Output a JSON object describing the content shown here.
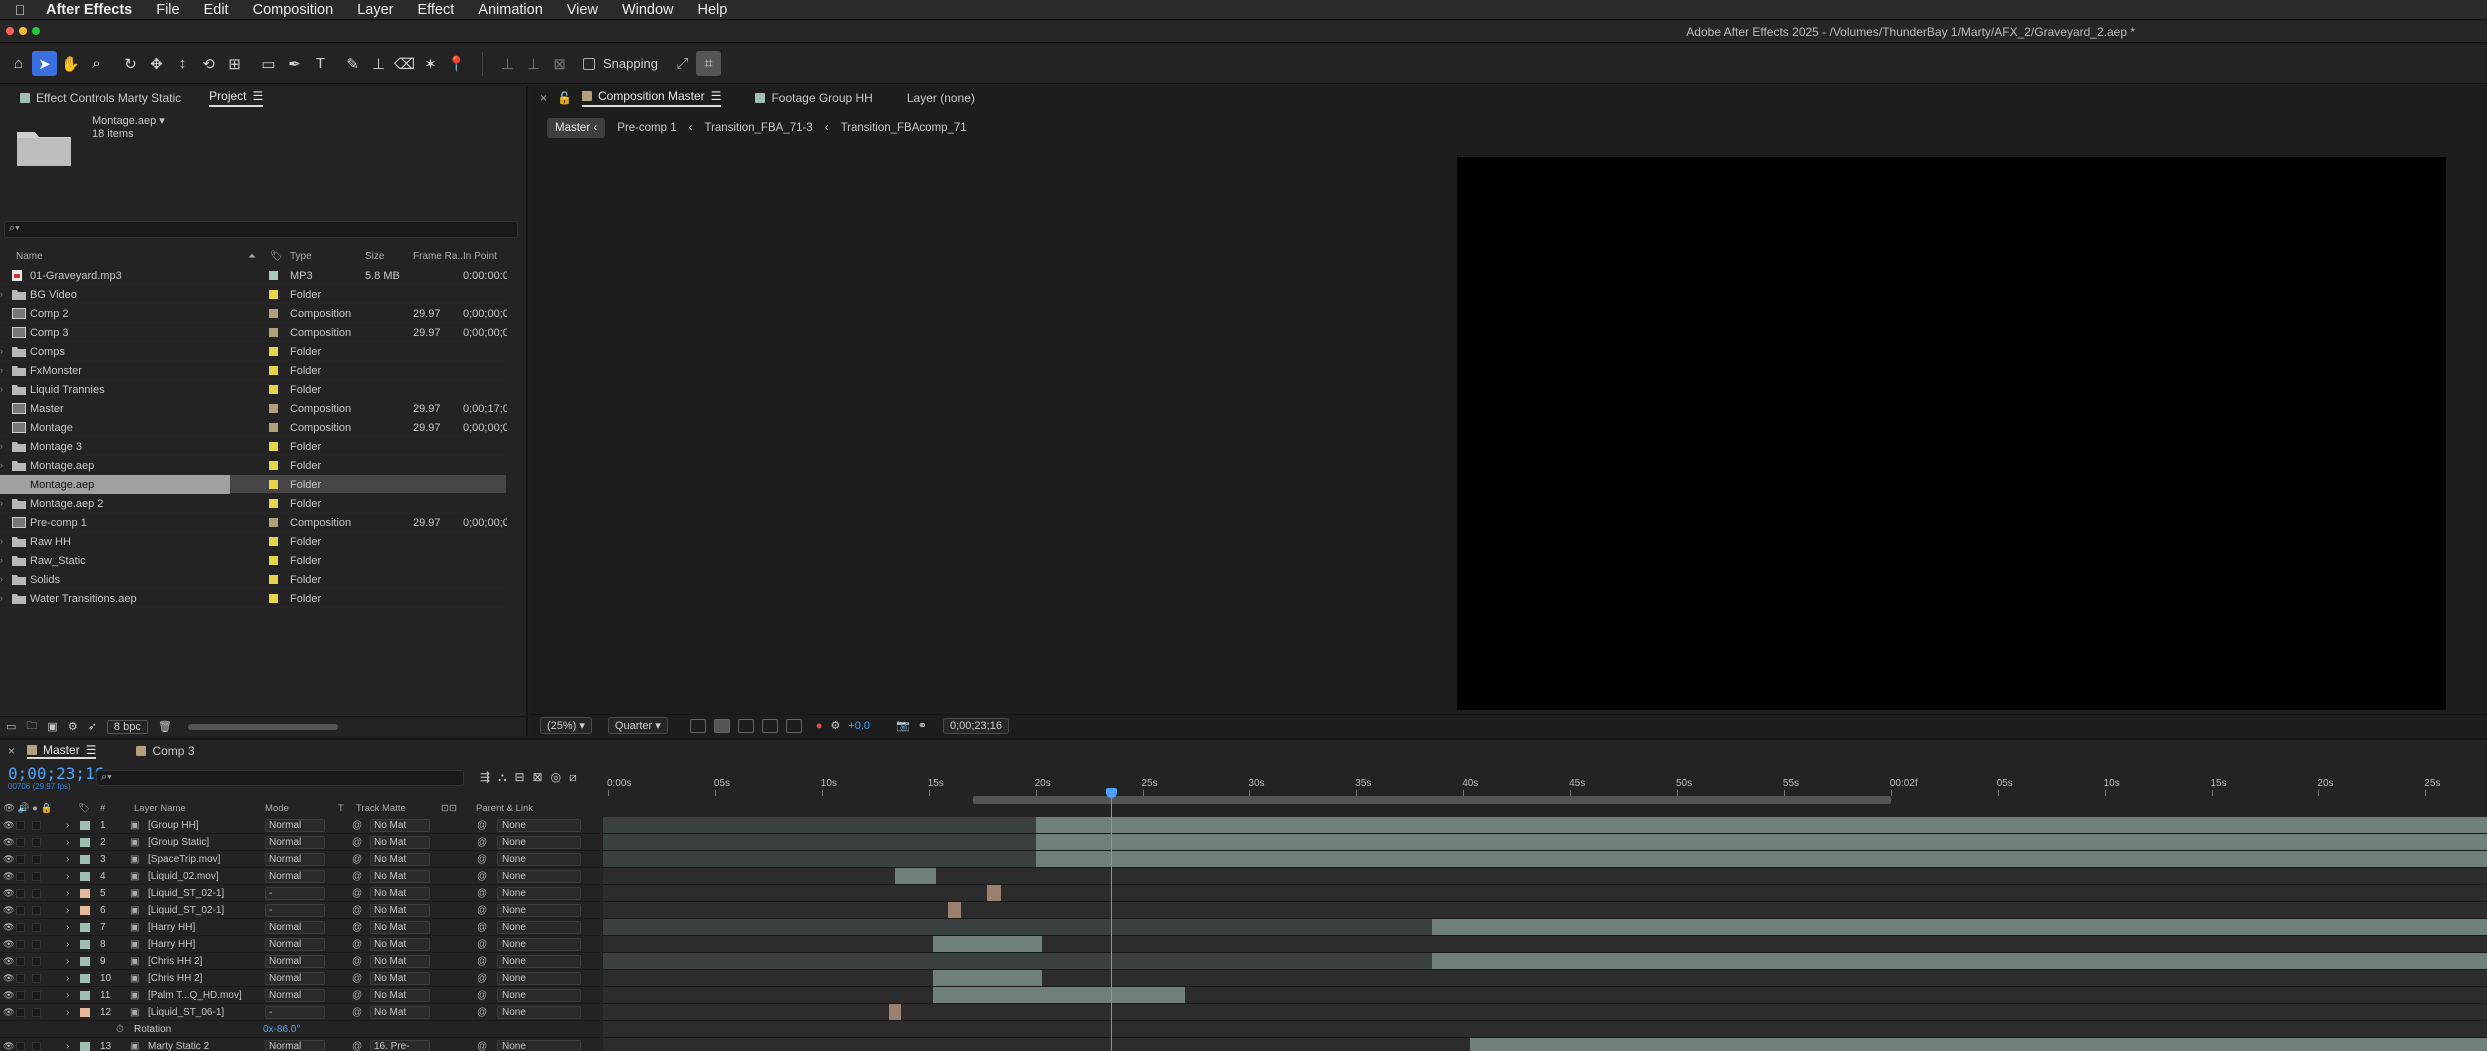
{
  "menubar": {
    "app_name": "After Effects",
    "items": [
      "File",
      "Edit",
      "Composition",
      "Layer",
      "Effect",
      "Animation",
      "View",
      "Window",
      "Help"
    ]
  },
  "window": {
    "title": "Adobe After Effects 2025 - /Volumes/ThunderBay 1/Marty/AFX_2/Graveyard_2.aep *"
  },
  "toolbar": {
    "snapping_label": "Snapping"
  },
  "project_panel": {
    "tabs": [
      {
        "label": "Effect Controls Marty Static",
        "swatch": "#9fc0b0"
      },
      {
        "label": "Project"
      }
    ],
    "project_name": "Montage.aep ▾",
    "item_count": "18 items",
    "columns": {
      "name": "Name",
      "type": "Type",
      "size": "Size",
      "frame_rate": "Frame Ra...",
      "in_point": "In Point"
    },
    "files": [
      {
        "name": "01-Graveyard.mp3",
        "kind": "audio",
        "label": "#a8c8b8",
        "type": "MP3",
        "size": "5.8 MB",
        "fps": "",
        "in": "0:00:00:0"
      },
      {
        "name": "BG Video",
        "kind": "folder",
        "label": "#e8d44a",
        "type": "Folder",
        "size": "",
        "fps": "",
        "in": ""
      },
      {
        "name": "Comp 2",
        "kind": "comp",
        "label": "#b3a07a",
        "type": "Composition",
        "size": "",
        "fps": "29.97",
        "in": "0;00;00;0"
      },
      {
        "name": "Comp 3",
        "kind": "comp",
        "label": "#b3a07a",
        "type": "Composition",
        "size": "",
        "fps": "29.97",
        "in": "0;00;00;0"
      },
      {
        "name": "Comps",
        "kind": "folder",
        "label": "#e8d44a",
        "type": "Folder",
        "size": "",
        "fps": "",
        "in": ""
      },
      {
        "name": "FxMonster",
        "kind": "folder",
        "label": "#e8d44a",
        "type": "Folder",
        "size": "",
        "fps": "",
        "in": ""
      },
      {
        "name": "Liquid Trannies",
        "kind": "folder",
        "label": "#e8d44a",
        "type": "Folder",
        "size": "",
        "fps": "",
        "in": ""
      },
      {
        "name": "Master",
        "kind": "comp",
        "label": "#b3a07a",
        "type": "Composition",
        "size": "",
        "fps": "29.97",
        "in": "0;00;17;0"
      },
      {
        "name": "Montage",
        "kind": "comp",
        "label": "#b3a07a",
        "type": "Composition",
        "size": "",
        "fps": "29.97",
        "in": "0;00;00;0"
      },
      {
        "name": "Montage 3",
        "kind": "folder",
        "label": "#e8d44a",
        "type": "Folder",
        "size": "",
        "fps": "",
        "in": ""
      },
      {
        "name": "Montage.aep",
        "kind": "folder",
        "label": "#e8d44a",
        "type": "Folder",
        "size": "",
        "fps": "",
        "in": ""
      },
      {
        "name": "Montage.aep",
        "kind": "folder",
        "label": "#e8d44a",
        "type": "Folder",
        "size": "",
        "fps": "",
        "in": "",
        "selected": true
      },
      {
        "name": "Montage.aep 2",
        "kind": "folder",
        "label": "#e8d44a",
        "type": "Folder",
        "size": "",
        "fps": "",
        "in": ""
      },
      {
        "name": "Pre-comp 1",
        "kind": "comp",
        "label": "#b3a07a",
        "type": "Composition",
        "size": "",
        "fps": "29.97",
        "in": "0;00;00;0"
      },
      {
        "name": "Raw HH",
        "kind": "folder",
        "label": "#e8d44a",
        "type": "Folder",
        "size": "",
        "fps": "",
        "in": ""
      },
      {
        "name": "Raw_Static",
        "kind": "folder",
        "label": "#e8d44a",
        "type": "Folder",
        "size": "",
        "fps": "",
        "in": ""
      },
      {
        "name": "Solids",
        "kind": "folder",
        "label": "#e8d44a",
        "type": "Folder",
        "size": "",
        "fps": "",
        "in": ""
      },
      {
        "name": "Water Transitions.aep",
        "kind": "folder",
        "label": "#e8d44a",
        "type": "Folder",
        "size": "",
        "fps": "",
        "in": ""
      }
    ],
    "bpc": "8 bpc"
  },
  "viewer": {
    "tabs": [
      {
        "label": "Composition Master",
        "swatch": "#b3a07a",
        "active": true
      },
      {
        "label": "Footage Group HH",
        "swatch": "#9fc0b0"
      },
      {
        "label": "Layer (none)"
      }
    ],
    "breadcrumbs": [
      "Master",
      "Pre-comp 1",
      "Transition_FBA_71-3",
      "Transition_FBAcomp_71"
    ],
    "zoom": "(25%)",
    "resolution": "Quarter",
    "exposure": "+0.0",
    "timecode": "0;00;23;16"
  },
  "timeline": {
    "tabs": [
      {
        "label": "Master",
        "swatch": "#b3a07a",
        "active": true
      },
      {
        "label": "Comp 3",
        "swatch": "#b3a07a"
      }
    ],
    "current_time": "0;00;23;16",
    "frame_info": "00706 (29.97 fps)",
    "columns": {
      "num": "#",
      "name": "Layer Name",
      "mode": "Mode",
      "t": "T",
      "track_matte": "Track Matte",
      "parent": "Parent & Link"
    },
    "ruler": [
      "0:00s",
      "05s",
      "10s",
      "15s",
      "20s",
      "25s",
      "30s",
      "35s",
      "40s",
      "45s",
      "50s",
      "55s",
      "00:02f",
      "05s",
      "10s",
      "15s",
      "20s",
      "25s"
    ],
    "layers": [
      {
        "num": "1",
        "name": "[Group HH]",
        "label": "#9fc0b0",
        "mode": "Normal",
        "matte": "No Mat",
        "parent": "None",
        "bars": [
          [
            0.0,
            0.23,
            "d"
          ],
          [
            0.23,
            1.0,
            "g"
          ]
        ]
      },
      {
        "num": "2",
        "name": "[Group Static]",
        "label": "#9fc0b0",
        "mode": "Normal",
        "matte": "No Mat",
        "parent": "None",
        "bars": [
          [
            0.0,
            0.23,
            "d"
          ],
          [
            0.23,
            1.0,
            "g"
          ]
        ]
      },
      {
        "num": "3",
        "name": "[SpaceTrip.mov]",
        "label": "#9fc0b0",
        "mode": "Normal",
        "matte": "No Mat",
        "parent": "None",
        "bars": [
          [
            0.0,
            0.23,
            "d"
          ],
          [
            0.23,
            1.0,
            "g"
          ]
        ]
      },
      {
        "num": "4",
        "name": "[Liquid_02.mov]",
        "label": "#9fc0b0",
        "mode": "Normal",
        "matte": "No Mat",
        "parent": "None",
        "bars": [
          [
            0.155,
            0.177,
            "g"
          ]
        ]
      },
      {
        "num": "5",
        "name": "[Liquid_ST_02-1]",
        "label": "#e8b89a",
        "mode": "-",
        "matte": "No Mat",
        "parent": "None",
        "bars": [
          [
            0.204,
            0.211,
            "p"
          ]
        ]
      },
      {
        "num": "6",
        "name": "[Liquid_ST_02-1]",
        "label": "#e8b89a",
        "mode": "-",
        "matte": "No Mat",
        "parent": "None",
        "bars": [
          [
            0.183,
            0.19,
            "p"
          ]
        ]
      },
      {
        "num": "7",
        "name": "[Harry HH]",
        "label": "#9fc0b0",
        "mode": "Normal",
        "matte": "No Mat",
        "parent": "None",
        "bars": [
          [
            0.0,
            0.44,
            "d"
          ],
          [
            0.44,
            1.0,
            "g"
          ]
        ]
      },
      {
        "num": "8",
        "name": "[Harry HH]",
        "label": "#9fc0b0",
        "mode": "Normal",
        "matte": "No Mat",
        "parent": "None",
        "bars": [
          [
            0.175,
            0.233,
            "g"
          ]
        ]
      },
      {
        "num": "9",
        "name": "[Chris HH 2]",
        "label": "#9fc0b0",
        "mode": "Normal",
        "matte": "No Mat",
        "parent": "None",
        "bars": [
          [
            0.0,
            0.44,
            "d"
          ],
          [
            0.44,
            1.0,
            "g"
          ]
        ]
      },
      {
        "num": "10",
        "name": "[Chris HH 2]",
        "label": "#9fc0b0",
        "mode": "Normal",
        "matte": "No Mat",
        "parent": "None",
        "bars": [
          [
            0.175,
            0.233,
            "g"
          ]
        ]
      },
      {
        "num": "11",
        "name": "[Palm T...Q_HD.mov]",
        "label": "#9fc0b0",
        "mode": "Normal",
        "matte": "No Mat",
        "parent": "None",
        "bars": [
          [
            0.175,
            0.309,
            "g"
          ]
        ]
      },
      {
        "num": "12",
        "name": "[Liquid_ST_06-1]",
        "label": "#e8b89a",
        "mode": "-",
        "matte": "No Mat",
        "parent": "None",
        "bars": [
          [
            0.152,
            0.158,
            "p"
          ]
        ]
      },
      {
        "num": "",
        "name": "Rotation",
        "label": "",
        "mode": "",
        "matte": "",
        "parent": "",
        "value": "0x-86.0°",
        "bars": []
      },
      {
        "num": "13",
        "name": "Marty Static 2",
        "label": "#9fc0b0",
        "mode": "Normal",
        "matte": "16. Pre-",
        "parent": "None",
        "bars": [
          [
            0.46,
            1.0,
            "g"
          ]
        ]
      }
    ]
  }
}
